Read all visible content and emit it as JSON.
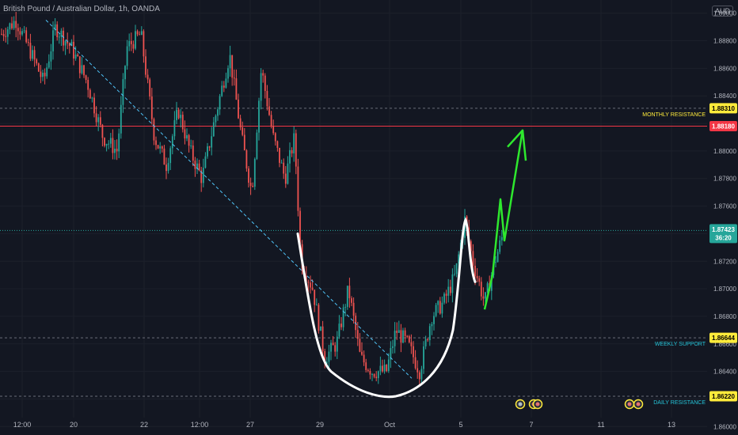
{
  "header": {
    "title": "British Pound / Australian Dollar, 1h, OANDA",
    "currency": "AUD"
  },
  "colors": {
    "background": "#131722",
    "up": "#26a69a",
    "down": "#ef5350",
    "monthly": "#f23645",
    "current": "#26a69a",
    "support_label": "#26c6da",
    "resistance_label": "#ffeb3b",
    "cup": "#ffffff",
    "arrow": "#2ee82e"
  },
  "chart_data": {
    "type": "candlestick",
    "y_ticks": [
      "1.89000",
      "1.88800",
      "1.88600",
      "1.88400",
      "1.88200",
      "1.88000",
      "1.87800",
      "1.87600",
      "1.87400",
      "1.87200",
      "1.87000",
      "1.86800",
      "1.86600",
      "1.86400",
      "1.86200",
      "1.86000"
    ],
    "x_ticks": [
      "12:00",
      "20",
      "22",
      "12:00",
      "27",
      "29",
      "Oct",
      "5",
      "7",
      "11",
      "13"
    ],
    "ylim": [
      1.8595,
      1.8905
    ],
    "levels": [
      {
        "value": 1.8831,
        "label": "1.88310",
        "name": "MONTHLY RESISTANCE",
        "style": "dashed",
        "tag": "yellow"
      },
      {
        "value": 1.8818,
        "label": "1.88180",
        "name": "",
        "style": "solid-red",
        "tag": "red"
      },
      {
        "value": 1.87423,
        "label": "1.87423",
        "name": "",
        "style": "dotted-green",
        "tag": "green",
        "countdown": "36:20"
      },
      {
        "value": 1.86644,
        "label": "1.86644",
        "name": "WEEKLY SUPPORT",
        "style": "dashed",
        "tag": "yellow"
      },
      {
        "value": 1.8622,
        "label": "1.86220",
        "name": "DAILY RESISTANCE",
        "style": "dashed",
        "tag": "yellow"
      }
    ]
  }
}
